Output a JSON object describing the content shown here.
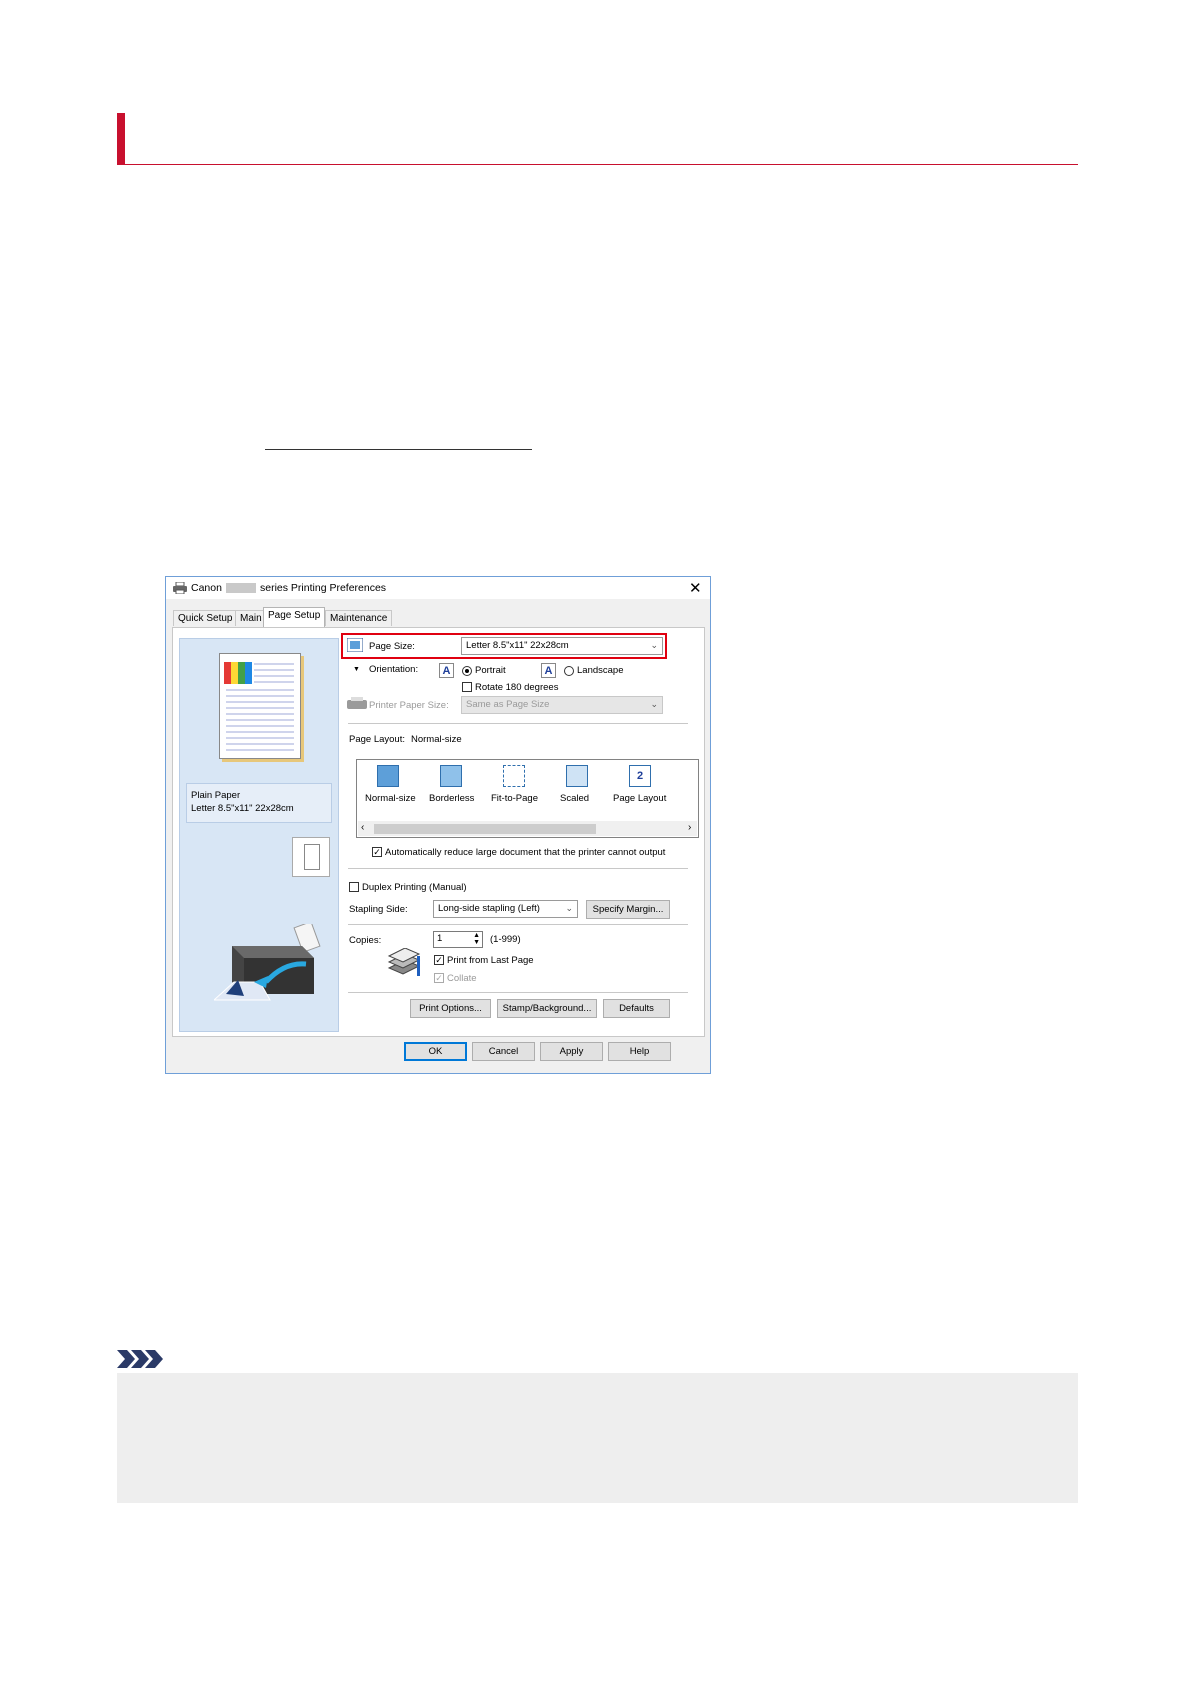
{
  "dialog": {
    "title_prefix": "Canon",
    "title_suffix": "series Printing Preferences",
    "tabs": [
      "Quick Setup",
      "Main",
      "Page Setup",
      "Maintenance"
    ],
    "active_tab": "Page Setup",
    "media": {
      "line1": "Plain Paper",
      "line2": "Letter 8.5\"x11\" 22x28cm"
    },
    "page_size": {
      "label": "Page Size:",
      "value": "Letter 8.5\"x11\" 22x28cm"
    },
    "orientation": {
      "label": "Orientation:",
      "portrait": "Portrait",
      "landscape": "Landscape",
      "selected": "Portrait",
      "rotate_label": "Rotate 180 degrees",
      "rotate_checked": false
    },
    "printer_paper_size": {
      "label": "Printer Paper Size:",
      "value": "Same as Page Size",
      "disabled": true
    },
    "page_layout": {
      "label": "Page Layout:",
      "value": "Normal-size",
      "options": [
        "Normal-size",
        "Borderless",
        "Fit-to-Page",
        "Scaled",
        "Page Layout"
      ]
    },
    "auto_reduce": {
      "label": "Automatically reduce large document that the printer cannot output",
      "checked": true
    },
    "duplex": {
      "label": "Duplex Printing (Manual)",
      "checked": false
    },
    "stapling": {
      "label": "Stapling Side:",
      "value": "Long-side stapling (Left)",
      "margin_button": "Specify Margin..."
    },
    "copies": {
      "label": "Copies:",
      "value": "1",
      "range": "(1-999)",
      "print_last_label": "Print from Last Page",
      "print_last_checked": true,
      "collate_label": "Collate",
      "collate_checked": true
    },
    "action_buttons": [
      "Print Options...",
      "Stamp/Background...",
      "Defaults"
    ],
    "footer_buttons": [
      "OK",
      "Cancel",
      "Apply",
      "Help"
    ]
  },
  "colors": {
    "accent_red": "#c8102e",
    "highlight_red": "#e00010",
    "preview_bg": "#d8e6f5"
  }
}
